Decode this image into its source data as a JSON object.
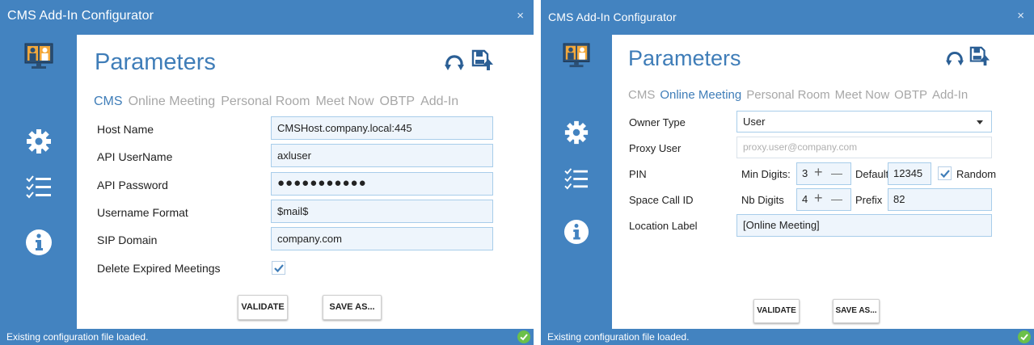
{
  "colors": {
    "accent": "#4383c0",
    "heading": "#3f7db8",
    "field_bg": "#eef5fc",
    "field_border": "#a8cdea",
    "ok": "#6cc04a"
  },
  "left_window": {
    "title": "CMS Add-In Configurator",
    "close_glyph": "×",
    "heading": "Parameters",
    "tabs": [
      {
        "label": "CMS",
        "active": true
      },
      {
        "label": "Online Meeting",
        "active": false
      },
      {
        "label": "Personal Room",
        "active": false
      },
      {
        "label": "Meet Now",
        "active": false
      },
      {
        "label": "OBTP",
        "active": false
      },
      {
        "label": "Add-In",
        "active": false
      }
    ],
    "fields": {
      "host_name": {
        "label": "Host Name",
        "value": "CMSHost.company.local:445"
      },
      "api_username": {
        "label": "API UserName",
        "value": "axluser"
      },
      "api_password": {
        "label": "API Password",
        "value": "●●●●●●●●●●●"
      },
      "username_format": {
        "label": "Username Format",
        "value": "$mail$"
      },
      "sip_domain": {
        "label": "SIP Domain",
        "value": "company.com"
      },
      "delete_expired": {
        "label": "Delete Expired Meetings",
        "checked": true
      }
    },
    "buttons": {
      "validate": "VALIDATE",
      "save_as": "SAVE AS..."
    },
    "status": "Existing configuration file loaded."
  },
  "right_window": {
    "title": "CMS Add-In Configurator",
    "close_glyph": "×",
    "heading": "Parameters",
    "tabs": [
      {
        "label": "CMS",
        "active": false
      },
      {
        "label": "Online Meeting",
        "active": true
      },
      {
        "label": "Personal Room",
        "active": false
      },
      {
        "label": "Meet Now",
        "active": false
      },
      {
        "label": "OBTP",
        "active": false
      },
      {
        "label": "Add-In",
        "active": false
      }
    ],
    "owner_type": {
      "label": "Owner Type",
      "value": "User"
    },
    "proxy_user": {
      "label": "Proxy User",
      "placeholder": "proxy.user@company.com"
    },
    "pin": {
      "label": "PIN",
      "min_digits_label": "Min Digits:",
      "min_digits": "3",
      "default_label": "Default",
      "default_value": "12345",
      "random_label": "Random",
      "random_checked": true
    },
    "space_call_id": {
      "label": "Space Call ID",
      "nb_digits_label": "Nb Digits",
      "nb_digits": "4",
      "prefix_label": "Prefix",
      "prefix_value": "82"
    },
    "location_label": {
      "label": "Location Label",
      "value": "[Online Meeting]"
    },
    "stepper": {
      "plus": "+",
      "minus": "—"
    },
    "buttons": {
      "validate": "VALIDATE",
      "save_as": "SAVE AS..."
    },
    "status": "Existing configuration file loaded."
  },
  "icons": [
    "monitor-users-icon",
    "gear-icon",
    "checklist-icon",
    "info-icon",
    "refresh-icon",
    "save-upload-icon",
    "check-icon",
    "ok-status-icon"
  ]
}
